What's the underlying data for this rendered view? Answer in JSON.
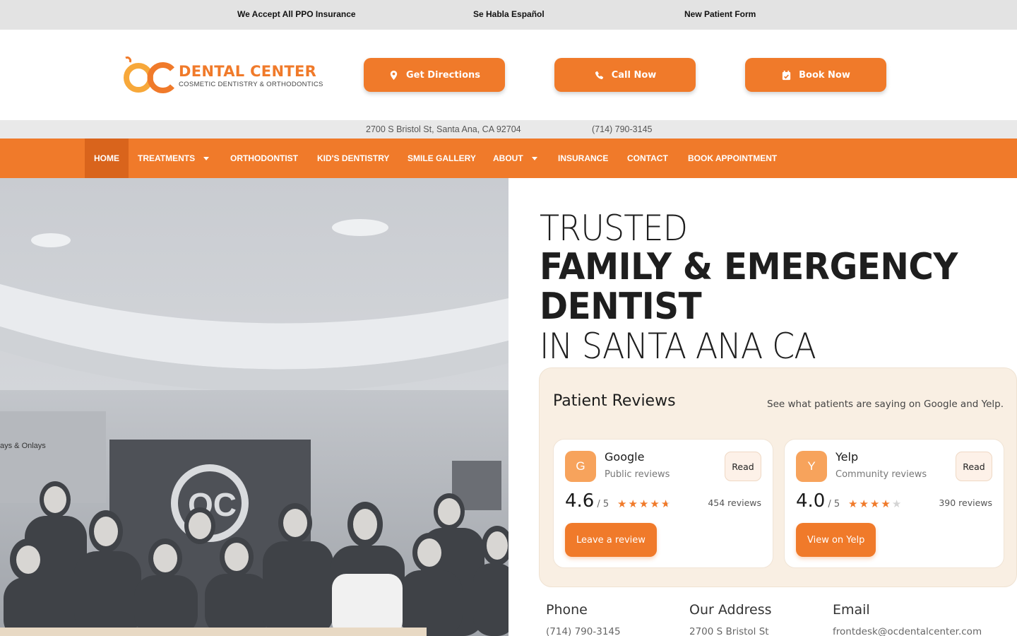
{
  "topbar": {
    "links": [
      "We Accept All PPO Insurance",
      "Se Habla Español",
      "New Patient Form"
    ]
  },
  "header": {
    "logo": {
      "letters": "OC",
      "main": "DENTAL CENTER",
      "sub": "COSMETIC DENTISTRY & ORTHODONTICS"
    },
    "buttons": {
      "directions": "Get Directions",
      "call": "Call Now",
      "book": "Book Now"
    }
  },
  "info": {
    "address": "2700 S Bristol St, Santa Ana, CA 92704",
    "phone": "(714) 790-3145"
  },
  "nav": {
    "items": [
      "HOME",
      "TREATMENTS",
      "ORTHODONTIST",
      "KID'S DENTISTRY",
      "SMILE GALLERY",
      "ABOUT",
      "INSURANCE",
      "CONTACT",
      "BOOK APPOINTMENT"
    ]
  },
  "photo": {
    "wall_sign": "ays & Onlays",
    "logo_letters": "OC"
  },
  "hero": {
    "line1": "TRUSTED",
    "line2": "FAMILY & EMERGENCY",
    "line3": "DENTIST",
    "line4": "IN SANTA ANA CA"
  },
  "reviews": {
    "title": "Patient Reviews",
    "subtitle": "See what patients are saying on Google and Yelp.",
    "cards": [
      {
        "badge": "G",
        "name": "Google",
        "desc": "Public reviews",
        "read": "Read",
        "score": "4.6",
        "out_of": "/ 5",
        "rating": 4.6,
        "count": "454 reviews",
        "cta": "Leave a review"
      },
      {
        "badge": "Y",
        "name": "Yelp",
        "desc": "Community reviews",
        "read": "Read",
        "score": "4.0",
        "out_of": "/ 5",
        "rating": 4.0,
        "count": "390 reviews",
        "cta": "View on Yelp"
      }
    ]
  },
  "contact": {
    "phone_label": "Phone",
    "phone_value": "(714) 790-3145",
    "address_label": "Our Address",
    "address_value": "2700 S Bristol St",
    "email_label": "Email",
    "email_value": "frontdesk@ocdentalcenter.com"
  },
  "colors": {
    "brand_orange": "#f07a2a",
    "nav_active": "#d9641c",
    "panel_bg": "#f9efe3"
  }
}
